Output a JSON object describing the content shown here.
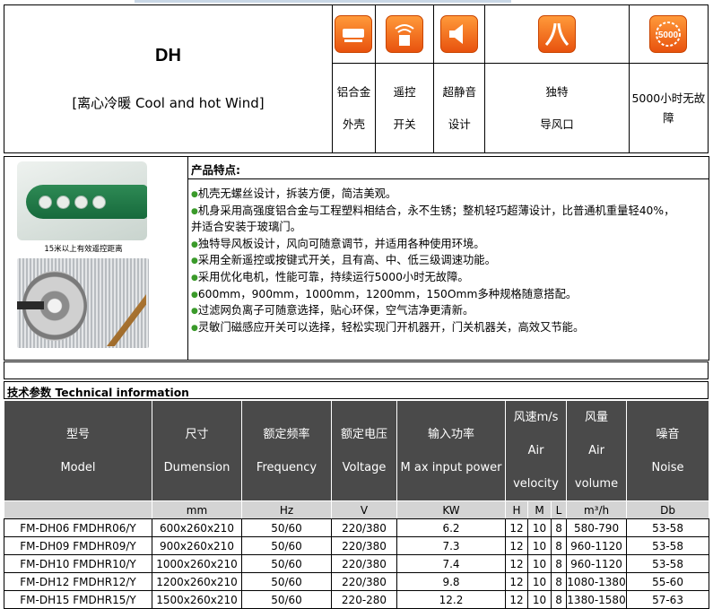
{
  "header": {
    "model": "DH",
    "subtitle": "[离心冷暖 Cool and hot Wind]",
    "features": [
      {
        "icon": "aluminum-shell-icon",
        "line1": "铝合金",
        "line2": "外壳"
      },
      {
        "icon": "remote-switch-icon",
        "line1": "遥控",
        "line2": "开关"
      },
      {
        "icon": "silent-design-icon",
        "line1": "超静音",
        "line2": "设计"
      },
      {
        "icon": "air-guide-icon",
        "line1": "独特",
        "line2": "导风口"
      },
      {
        "icon": "5000-hours-badge-icon",
        "badge": "5000",
        "line1": "5000小时无故",
        "line2": "障"
      }
    ]
  },
  "product": {
    "heading": "产品特点:",
    "remote_caption": "15米以上有效遥控距离",
    "bullets": [
      "机壳无螺丝设计，拆装方便，简洁美观。",
      "机身采用高强度铝合金与工程塑料相结合，永不生锈；整机轻巧超薄设计，比普通机重量轻40%，",
      "并适合安装于玻璃门。",
      "独特导风板设计，风向可随意调节，并适用各种使用环境。",
      "采用全新遥控或按键式开关，且有高、中、低三级调速功能。",
      "采用优化电机，性能可靠，持续运行5000小时无故障。",
      "600mm，900mm，1000mm，1200mm，150Omm多种规格随意搭配。",
      "过滤网负离子可随意选择，贴心环保，空气洁净更清新。",
      "灵敏门磁感应开关可以选择，轻松实现门开机器开，门关机器关，高效又节能。"
    ]
  },
  "tech_title": "技术参数 Technical information",
  "specs": {
    "columns": [
      {
        "cn": "型号",
        "en": "Model",
        "unit": ""
      },
      {
        "cn": "尺寸",
        "en": "Dumension",
        "unit": "mm"
      },
      {
        "cn": "额定频率",
        "en": "Frequency",
        "unit": "Hz"
      },
      {
        "cn": "额定电压",
        "en": "Voltage",
        "unit": "V"
      },
      {
        "cn": "输入功率",
        "en": "M ax input power",
        "unit": "KW"
      },
      {
        "cn": "风速m/s",
        "en": "Air velocity",
        "units": [
          "H",
          "M",
          "L"
        ]
      },
      {
        "cn": "风量",
        "en": "Air volume",
        "unit": "m³/h"
      },
      {
        "cn": "噪音",
        "en": "Noise",
        "unit": "Db"
      }
    ],
    "rows": [
      [
        "FM-DH06 FMDHR06/Y",
        "600x260x210",
        "50/60",
        "220/380",
        "6.2",
        "12",
        "10",
        "8",
        "580-790",
        "53-58"
      ],
      [
        "FM-DH09 FMDHR09/Y",
        "900x260x210",
        "50/60",
        "220/380",
        "7.3",
        "12",
        "10",
        "8",
        "960-1120",
        "53-58"
      ],
      [
        "FM-DH10 FMDHR10/Y",
        "1000x260x210",
        "50/60",
        "220/380",
        "7.4",
        "12",
        "10",
        "8",
        "960-1120",
        "53-58"
      ],
      [
        "FM-DH12 FMDHR12/Y",
        "1200x260x210",
        "50/60",
        "220/380",
        "9.8",
        "12",
        "10",
        "8",
        "1080-1380",
        "55-60"
      ],
      [
        "FM-DH15 FMDHR15/Y",
        "1500x260x210",
        "50/60",
        "220-280",
        "12.2",
        "12",
        "10",
        "8",
        "1380-1580",
        "57-63"
      ]
    ]
  }
}
